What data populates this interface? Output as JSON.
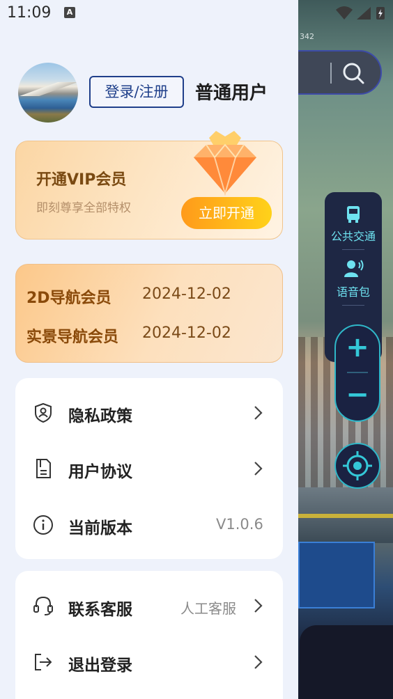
{
  "status_bar": {
    "time": "11:09",
    "notification_icon": "A"
  },
  "map": {
    "scale_text": "342",
    "tools": [
      {
        "label": "公共交通",
        "icon": "bus-icon"
      },
      {
        "label": "语音包",
        "icon": "voice-person-icon"
      }
    ],
    "zoom_in": "+",
    "zoom_out": "−"
  },
  "drawer": {
    "login_label": "登录/注册",
    "user_type": "普通用户",
    "vip": {
      "title": "开通VIP会员",
      "subtitle": "即刻尊享全部特权",
      "button": "立即开通"
    },
    "memberships": [
      {
        "label": "2D导航会员",
        "date": "2024-12-02"
      },
      {
        "label": "实景导航会员",
        "date": "2024-12-02"
      }
    ],
    "menu_group_1": [
      {
        "label": "隐私政策",
        "icon": "shield-person-icon",
        "value": ""
      },
      {
        "label": "用户协议",
        "icon": "document-icon",
        "value": ""
      },
      {
        "label": "当前版本",
        "icon": "info-icon",
        "value": "V1.0.6"
      }
    ],
    "menu_group_2": [
      {
        "label": "联系客服",
        "icon": "headset-icon",
        "value": "人工客服"
      },
      {
        "label": "退出登录",
        "icon": "logout-icon",
        "value": ""
      }
    ]
  }
}
